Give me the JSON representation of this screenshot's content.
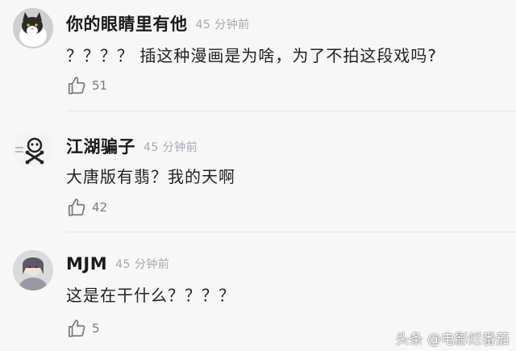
{
  "comments": [
    {
      "username": "你的眼睛里有他",
      "time": "45 分钟前",
      "text": "？？？？ 插这种漫画是为啥，为了不拍这段戏吗?",
      "likes": "51",
      "avatar": "cat-avatar"
    },
    {
      "username": "江湖骗子",
      "time": "45 分钟前",
      "text": "大唐版有翡？我的天啊",
      "likes": "42",
      "avatar": "skull-bone-avatar"
    },
    {
      "username": "MJM",
      "time": "45 分钟前",
      "text": "这是在干什么？？？？",
      "likes": "5",
      "avatar": "portrait-avatar"
    }
  ],
  "watermark": "头条 @电影烂番茄",
  "icons": {
    "like": "thumbs-up-icon"
  },
  "colors": {
    "background": "#f7f7f8",
    "time": "#a8a8ae",
    "like": "#7a7a80"
  }
}
